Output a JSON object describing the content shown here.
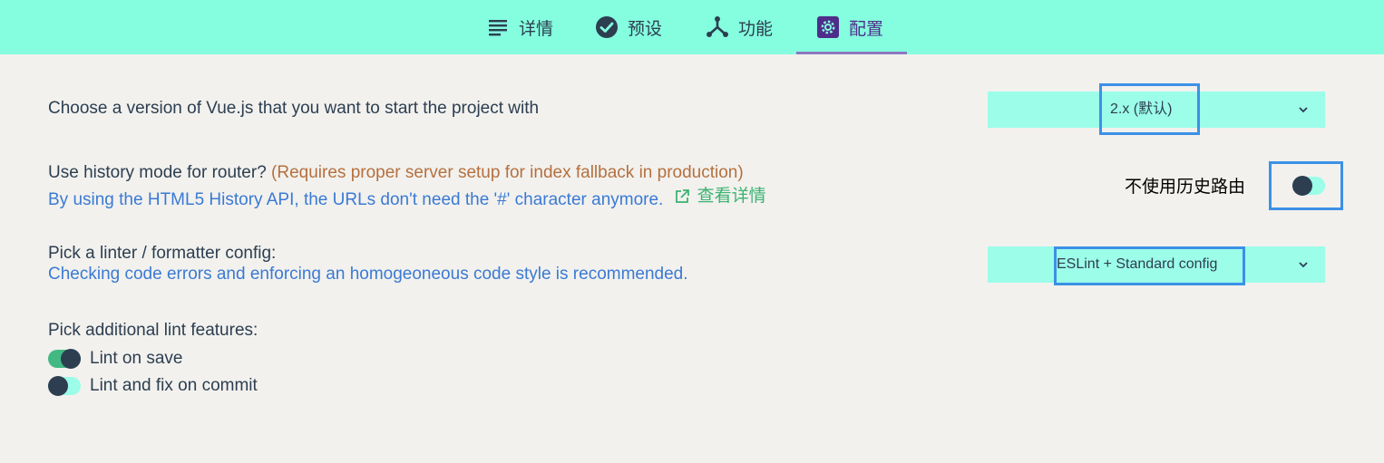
{
  "tabs": [
    {
      "label": "详情",
      "icon": "list-icon"
    },
    {
      "label": "预设",
      "icon": "check-circle-icon"
    },
    {
      "label": "功能",
      "icon": "fork-icon"
    },
    {
      "label": "配置",
      "icon": "gear-icon"
    }
  ],
  "vue_version": {
    "label": "Choose a version of Vue.js that you want to start the project with",
    "selected": "2.x (默认)"
  },
  "router": {
    "label": "Use history mode for router?",
    "warning": "(Requires proper server setup for index fallback in production)",
    "description": "By using the HTML5 History API, the URLs don't need the '#' character anymore.",
    "link_label": "查看详情",
    "toggle_label": "不使用历史路由",
    "toggle_on": false
  },
  "linter": {
    "label": "Pick a linter / formatter config:",
    "description": "Checking code errors and enforcing an homogeoneous code style is recommended.",
    "selected": "ESLint + Standard config"
  },
  "lint_features": {
    "label": "Pick additional lint features:",
    "items": [
      {
        "label": "Lint on save",
        "on": true
      },
      {
        "label": "Lint and fix on commit",
        "on": false
      }
    ]
  },
  "colors": {
    "accent": "#85fedf",
    "toggle_on": "#42b983",
    "link": "#3a7ad3",
    "warning": "#b5703e",
    "highlight": "#3c91e6"
  }
}
